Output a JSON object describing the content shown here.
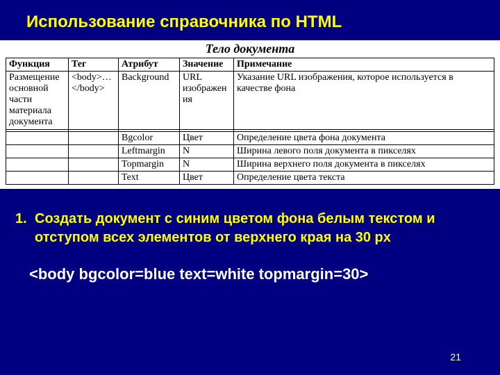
{
  "title": "Использование справочника по HTML",
  "table": {
    "caption": "Тело документа",
    "headers": [
      "Функция",
      "Тег",
      "Атрибут",
      "Значение",
      "Примечание"
    ],
    "rows": [
      [
        "Размещение основной части материала документа",
        "<body>…</body>",
        "Background",
        "URL изображения",
        "Указание URL изображения, которое используется в качестве фона"
      ],
      [
        "",
        "",
        "",
        "",
        ""
      ],
      [
        "",
        "",
        "Bgcolor",
        "Цвет",
        "Определение цвета фона документа"
      ],
      [
        "",
        "",
        "Leftmargin",
        "N",
        "Ширина левого поля документа в пикселях"
      ],
      [
        "",
        "",
        "Topmargin",
        "N",
        "Ширина верхнего поля документа в пикселях"
      ],
      [
        "",
        "",
        "Text",
        "Цвет",
        "Определение цвета текста"
      ]
    ]
  },
  "task": {
    "number": "1.",
    "text": "Создать документ с синим цветом фона белым текстом и отступом всех элементов от верхнего края на 30 px"
  },
  "code": "<body bgcolor=blue text=white topmargin=30>",
  "page": "21"
}
